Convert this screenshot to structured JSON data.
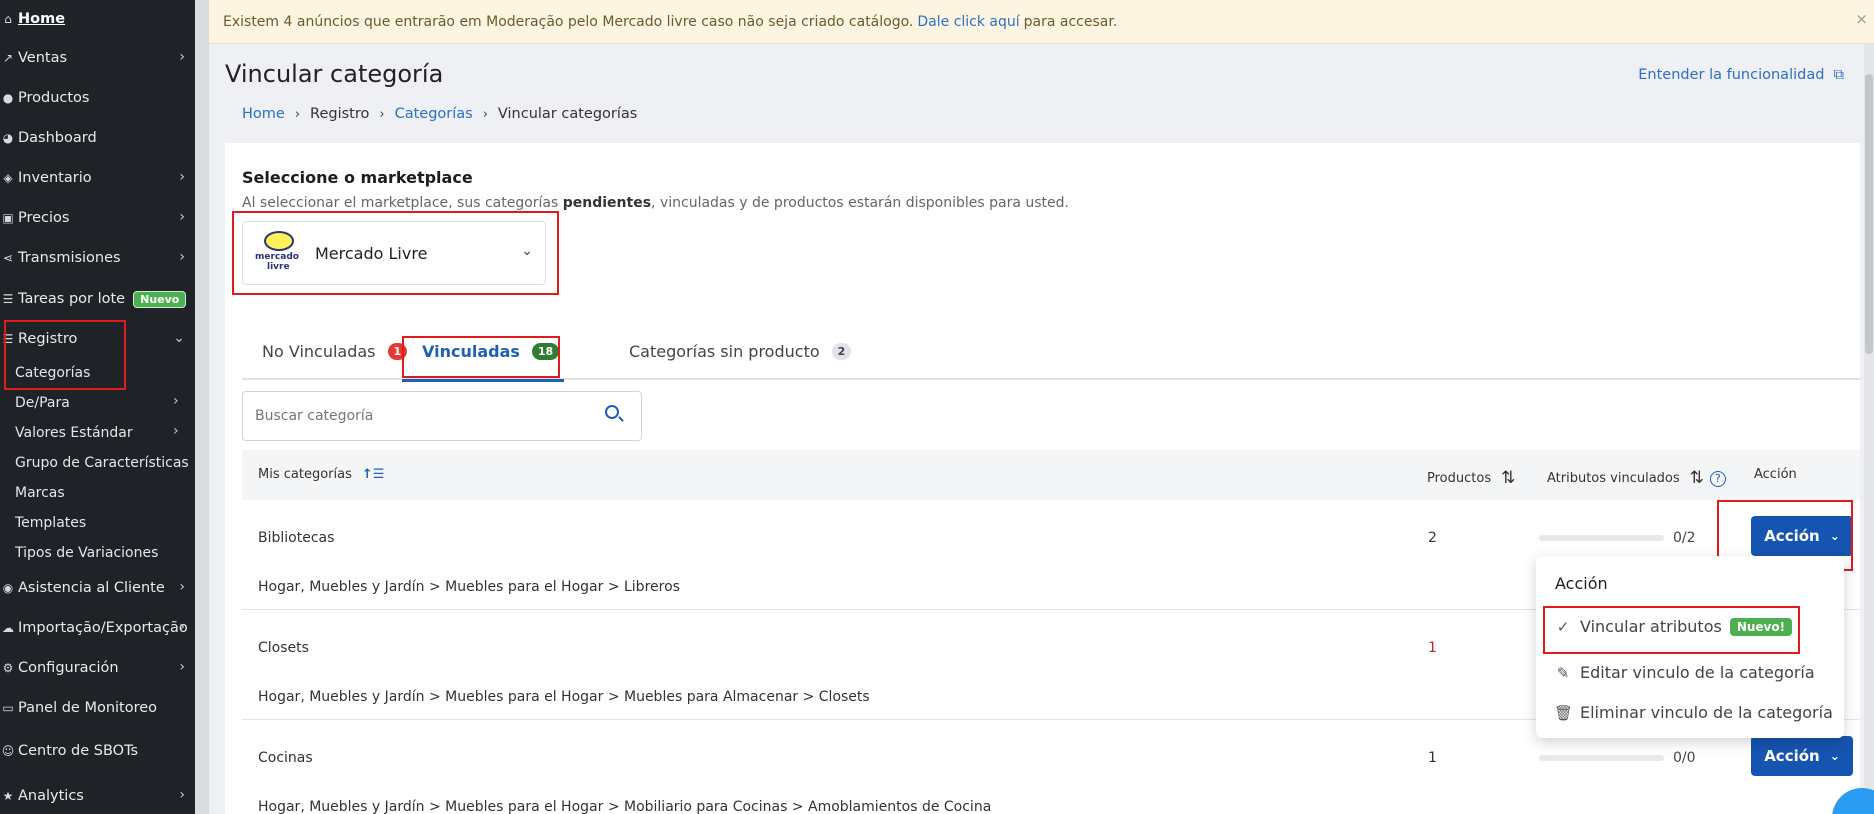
{
  "sidebar": {
    "items": [
      {
        "label": "Home",
        "icon": "home-icon",
        "glyph": "⌂"
      },
      {
        "label": "Ventas",
        "icon": "chart-line-icon",
        "glyph": "↗"
      },
      {
        "label": "Productos",
        "icon": "product-icon",
        "glyph": "●"
      },
      {
        "label": "Dashboard",
        "icon": "dashboard-icon",
        "glyph": "◕"
      },
      {
        "label": "Inventario",
        "icon": "inventory-icon",
        "glyph": "◈"
      },
      {
        "label": "Precios",
        "icon": "price-icon",
        "glyph": "▣"
      },
      {
        "label": "Transmisiones",
        "icon": "share-icon",
        "glyph": "⋖"
      },
      {
        "label": "Tareas por lote",
        "icon": "tasks-icon",
        "glyph": "☰",
        "badge": "Nuevo"
      },
      {
        "label": "Registro",
        "icon": "list-icon",
        "glyph": "☰"
      },
      {
        "label": "Asistencia al Cliente",
        "icon": "chat-icon",
        "glyph": "◉"
      },
      {
        "label": "Importação/Exportação",
        "icon": "cloud-icon",
        "glyph": "☁"
      },
      {
        "label": "Configuración",
        "icon": "gear-icon",
        "glyph": "⚙"
      },
      {
        "label": "Panel de Monitoreo",
        "icon": "monitor-icon",
        "glyph": "▭"
      },
      {
        "label": "Centro de SBOTs",
        "icon": "bot-icon",
        "glyph": "☺"
      },
      {
        "label": "Analytics",
        "icon": "star-icon",
        "glyph": "★"
      }
    ],
    "sub": {
      "categorias": "Categorías",
      "depara": "De/Para",
      "valores": "Valores Estándar",
      "grupo": "Grupo de Características",
      "marcas": "Marcas",
      "templates": "Templates",
      "tipos": "Tipos de Variaciones"
    }
  },
  "banner": {
    "text_before": "Existem 4 anúncios que entrarão em Moderação pelo Mercado livre caso não seja criado catálogo.",
    "link": "Dale click aquí",
    "text_after": "para accesar.",
    "close": "×"
  },
  "header": {
    "title": "Vincular categoría",
    "help_link": "Entender la funcionalidad",
    "breadcrumb": [
      "Home",
      "Registro",
      "Categorías",
      "Vincular categorías"
    ]
  },
  "marketplace": {
    "title": "Seleccione o marketplace",
    "desc_before": "Al seleccionar el marketplace, sus categorías ",
    "desc_bold": "pendientes",
    "desc_after": ", vinculadas y de productos estarán disponibles para usted.",
    "selected": "Mercado Livre",
    "logo_line1": "mercado",
    "logo_line2": "livre"
  },
  "tabs": [
    {
      "label": "No Vinculadas",
      "count": "1"
    },
    {
      "label": "Vinculadas",
      "count": "18"
    },
    {
      "label": "Categorías sin producto",
      "count": "2"
    }
  ],
  "search": {
    "placeholder": "Buscar categoría"
  },
  "table": {
    "headers": {
      "categories": "Mis categorías",
      "products": "Productos",
      "attributes": "Atributos vinculados",
      "action": "Acción"
    },
    "rows": [
      {
        "name": "Bibliotecas",
        "path": "Hogar, Muebles y Jardín > Muebles para el Hogar > Libreros",
        "products": "2",
        "ratio": "0/2",
        "action": "Acción"
      },
      {
        "name": "Closets",
        "path": "Hogar, Muebles y Jardín > Muebles para el Hogar > Muebles para Almacenar > Closets",
        "products": "1",
        "ratio": "",
        "action": ""
      },
      {
        "name": "Cocinas",
        "path": "Hogar, Muebles y Jardín > Muebles para el Hogar > Mobiliario para Cocinas > Amoblamientos de Cocina",
        "products": "1",
        "ratio": "0/0",
        "action": "Acción"
      }
    ]
  },
  "dropdown": {
    "title": "Acción",
    "items": [
      {
        "label": "Vincular atributos",
        "badge": "Nuevo!"
      },
      {
        "label": "Editar vinculo de la categoría"
      },
      {
        "label": "Eliminar vinculo de la categoría"
      }
    ]
  },
  "colors": {
    "accent": "#1554b0",
    "highlight": "#e01b1b",
    "sidebar": "#1f2227"
  }
}
